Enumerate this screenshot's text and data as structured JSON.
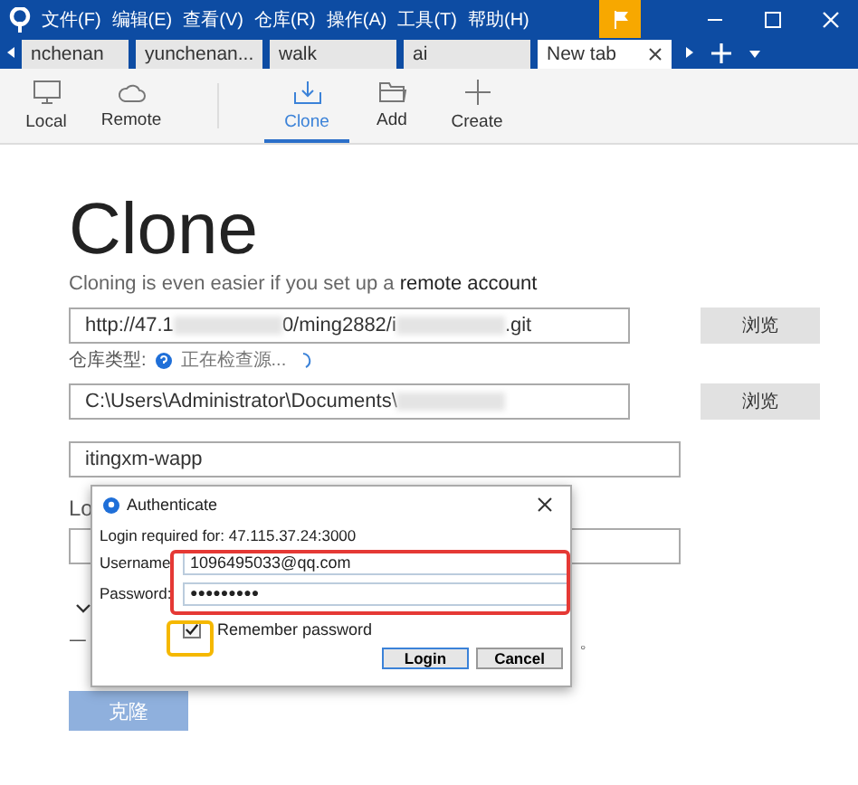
{
  "title_bar": {
    "menu": [
      "文件(F)",
      "编辑(E)",
      "查看(V)",
      "仓库(R)",
      "操作(A)",
      "工具(T)",
      "帮助(H)"
    ]
  },
  "tabs": [
    {
      "label": "nchenan",
      "selected": false
    },
    {
      "label": "yunchenan...",
      "selected": false
    },
    {
      "label": "walk",
      "selected": false
    },
    {
      "label": "ai",
      "selected": false
    },
    {
      "label": "New tab",
      "selected": true
    }
  ],
  "toolbar": [
    {
      "label": "Local",
      "kind": "monitor",
      "selected": false
    },
    {
      "label": "Remote",
      "kind": "cloud",
      "selected": false
    },
    {
      "label": "Clone",
      "kind": "download",
      "selected": true
    },
    {
      "label": "Add",
      "kind": "folder",
      "selected": false
    },
    {
      "label": "Create",
      "kind": "plus",
      "selected": false
    }
  ],
  "page": {
    "heading": "Clone",
    "subtitle": "Cloning is even easier if you set up a **remote account**",
    "source_field": {
      "parts": [
        {
          "kind": "text",
          "text": "http://47.1"
        },
        {
          "kind": "blur"
        },
        {
          "kind": "text",
          "text": "0/ming2882/i"
        },
        {
          "kind": "blur"
        },
        {
          "kind": "text",
          "text": ".git"
        }
      ]
    },
    "source_browse": "浏览",
    "repo_type_label": "仓库类型:",
    "repo_type_status": "正在检查源...",
    "path_field": {
      "parts": [
        {
          "kind": "text",
          "text": "C:\\Users\\Administrator\\Documents\\"
        },
        {
          "kind": "blur"
        }
      ]
    },
    "path_browse": "浏览",
    "name_field": "itingxm-wapp",
    "partial_label": "Lo",
    "note_start": "一",
    "note_end": "。",
    "clone_button": {
      "label": "克隆",
      "disabled": true
    }
  },
  "dialog": {
    "title": "Authenticate",
    "message": "Login required for: 47.115.37.24:3000",
    "fields": [
      {
        "label": "Username",
        "value": "1096495033@qq.com",
        "kind": "text"
      },
      {
        "label": "Password:",
        "value": "●●●●●●●●●",
        "kind": "password"
      }
    ],
    "remember": {
      "label": "Remember password",
      "checked": true
    },
    "buttons": [
      "Login",
      "Cancel"
    ]
  },
  "highlights": [
    {
      "color": "#e53935"
    },
    {
      "color": "#f5b800"
    }
  ]
}
